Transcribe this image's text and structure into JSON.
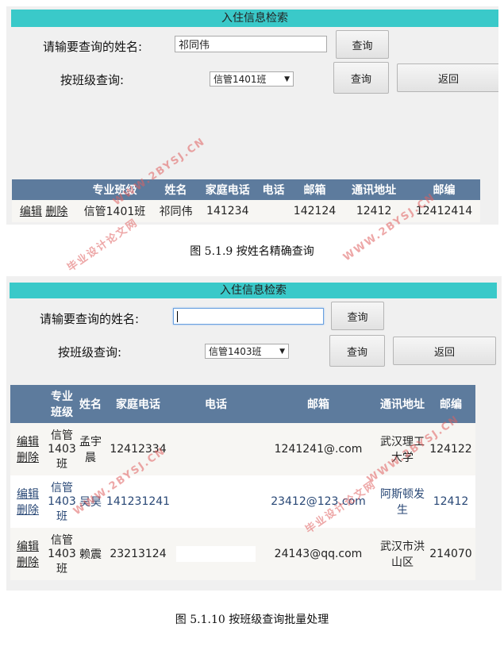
{
  "panel1": {
    "title": "入住信息检索",
    "name_label": "请输要查询的姓名:",
    "name_value": "祁同伟",
    "query_label": "查询",
    "class_label": "按班级查询:",
    "class_selected": "信管1401班",
    "query2_label": "查询",
    "back_label": "返回",
    "headers": [
      "",
      "专业班级",
      "姓名",
      "家庭电话",
      "电话",
      "邮箱",
      "通讯地址",
      "邮编"
    ],
    "rows": [
      {
        "edit": "编辑",
        "delete": "删除",
        "class": "信管1401班",
        "name": "祁同伟",
        "home_phone": "141234",
        "phone": "",
        "email": "142124",
        "address": "12412",
        "zip": "12412414"
      }
    ]
  },
  "caption1": "图 5.1.9 按姓名精确查询",
  "panel2": {
    "title": "入住信息检索",
    "name_label": "请输要查询的姓名:",
    "name_value": "",
    "query_label": "查询",
    "class_label": "按班级查询:",
    "class_selected": "信管1403班",
    "query2_label": "查询",
    "back_label": "返回",
    "headers": [
      "",
      "专业班级",
      "姓名",
      "家庭电话",
      "电话",
      "邮箱",
      "通讯地址",
      "邮编"
    ],
    "rows": [
      {
        "edit": "编辑",
        "delete": "删除",
        "class": "信管1403班",
        "name": "孟宇晨",
        "home_phone": "12412334",
        "phone": "",
        "email": "1241241@.com",
        "address": "武汉理工大学",
        "zip": "124122"
      },
      {
        "edit": "编辑",
        "delete": "删除",
        "class": "信管1403班",
        "name": "吴昊",
        "home_phone": "141231241",
        "phone": "",
        "email": "23412@123.com",
        "address": "阿斯顿发生",
        "zip": "12412"
      },
      {
        "edit": "编辑",
        "delete": "删除",
        "class": "信管1403班",
        "name": "赖震",
        "home_phone": "23213124",
        "phone": "",
        "email": "24143@qq.com",
        "address": "武汉市洪山区",
        "zip": "214070"
      }
    ]
  },
  "caption2": "图 5.1.10 按班级查询批量处理",
  "watermarks": {
    "site": "WWW.2BYSJ.CN",
    "cn": "毕业设计论文网"
  },
  "colors": {
    "title_bar": "#3ac9c9",
    "table_header": "#5d7b9d",
    "watermark": "#e06060"
  }
}
